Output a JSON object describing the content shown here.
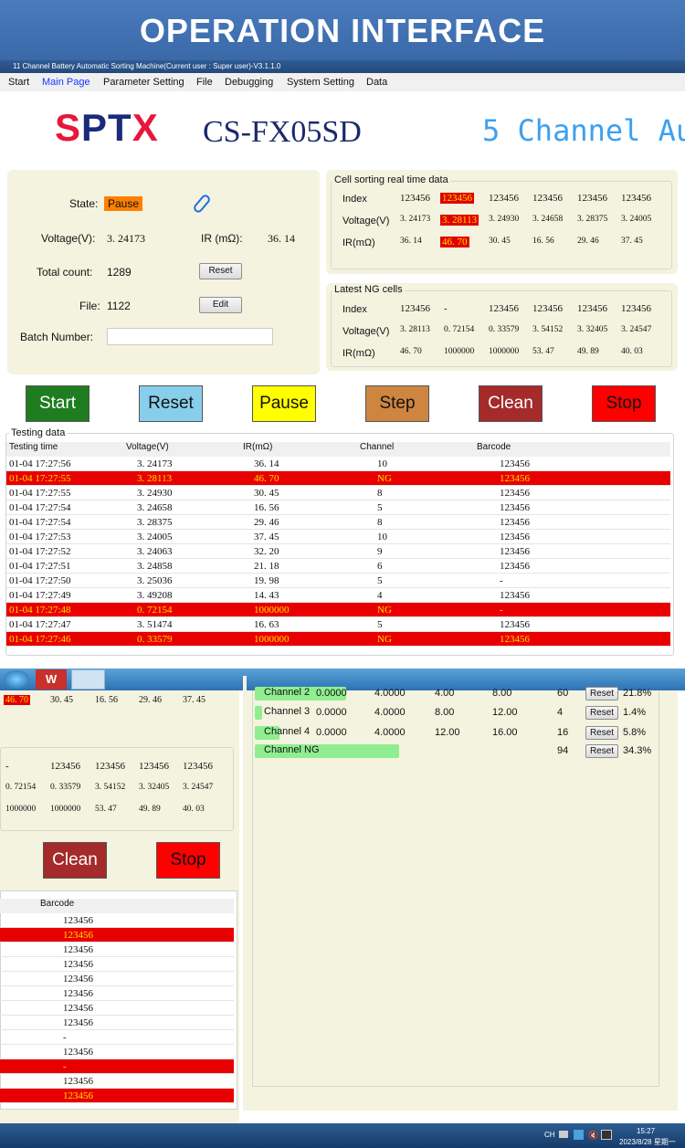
{
  "banner": {
    "title": "OPERATION INTERFACE"
  },
  "window": {
    "title": "11 Channel Battery Automatic Sorting Machine(Current user : Super user)-V3.1.1.0"
  },
  "menu": [
    "Start",
    "Main Page",
    "Parameter Setting",
    "File",
    "Debugging",
    "System Setting",
    "Data"
  ],
  "logo": {
    "brand": "SPTX",
    "model": "CS-FX05SD",
    "subtitle": "5 Channel Aut"
  },
  "status": {
    "state_label": "State:",
    "state_value": "Pause",
    "voltage_label": "Voltage(V):",
    "voltage_value": "3. 24173",
    "ir_label": "IR (mΩ):",
    "ir_value": "36. 14",
    "total_label": "Total count:",
    "total_value": "1289",
    "reset_label": "Reset",
    "file_label": "File:",
    "file_value": "1122",
    "edit_label": "Edit",
    "batch_label": "Batch Number:",
    "batch_value": ""
  },
  "realtime": {
    "title": "Cell sorting real time data",
    "row_labels": [
      "Index",
      "Voltage(V)",
      "IR(mΩ)"
    ],
    "index": [
      "123456",
      "123456",
      "123456",
      "123456",
      "123456",
      "123456"
    ],
    "voltage": [
      "3. 24173",
      "3. 28113",
      "3. 24930",
      "3. 24658",
      "3. 28375",
      "3. 24005"
    ],
    "ir": [
      "36. 14",
      "46. 70",
      "30. 45",
      "16. 56",
      "29. 46",
      "37. 45"
    ],
    "highlight_col": 1
  },
  "latest_ng": {
    "title": "Latest NG cells",
    "row_labels": [
      "Index",
      "Voltage(V)",
      "IR(mΩ)"
    ],
    "index": [
      "123456",
      "-",
      "123456",
      "123456",
      "123456",
      "123456"
    ],
    "voltage": [
      "3. 28113",
      "0. 72154",
      "0. 33579",
      "3. 54152",
      "3. 32405",
      "3. 24547"
    ],
    "ir": [
      "46. 70",
      "1000000",
      "1000000",
      "53. 47",
      "49. 89",
      "40. 03"
    ]
  },
  "buttons": [
    {
      "label": "Start",
      "color": "#1e7d1e",
      "text": "#ffffff"
    },
    {
      "label": "Reset",
      "color": "#87ceeb",
      "text": "#111111"
    },
    {
      "label": "Pause",
      "color": "#ffff00",
      "text": "#111111"
    },
    {
      "label": "Step",
      "color": "#cd853f",
      "text": "#111111"
    },
    {
      "label": "Clean",
      "color": "#a52a2a",
      "text": "#ffffff"
    },
    {
      "label": "Stop",
      "color": "#ff0000",
      "text": "#111111"
    }
  ],
  "testing": {
    "title": "Testing data",
    "columns": [
      "Testing time",
      "Voltage(V)",
      "IR(mΩ)",
      "Channel",
      "Barcode"
    ],
    "rows": [
      {
        "time": "01-04 17:27:56",
        "v": "3. 24173",
        "ir": "36. 14",
        "ch": "10",
        "bc": "123456",
        "ng": false
      },
      {
        "time": "01-04 17:27:55",
        "v": "3. 28113",
        "ir": "46. 70",
        "ch": "NG",
        "bc": "123456",
        "ng": true
      },
      {
        "time": "01-04 17:27:55",
        "v": "3. 24930",
        "ir": "30. 45",
        "ch": "8",
        "bc": "123456",
        "ng": false
      },
      {
        "time": "01-04 17:27:54",
        "v": "3. 24658",
        "ir": "16. 56",
        "ch": "5",
        "bc": "123456",
        "ng": false
      },
      {
        "time": "01-04 17:27:54",
        "v": "3. 28375",
        "ir": "29. 46",
        "ch": "8",
        "bc": "123456",
        "ng": false
      },
      {
        "time": "01-04 17:27:53",
        "v": "3. 24005",
        "ir": "37. 45",
        "ch": "10",
        "bc": "123456",
        "ng": false
      },
      {
        "time": "01-04 17:27:52",
        "v": "3. 24063",
        "ir": "32. 20",
        "ch": "9",
        "bc": "123456",
        "ng": false
      },
      {
        "time": "01-04 17:27:51",
        "v": "3. 24858",
        "ir": "21. 18",
        "ch": "6",
        "bc": "123456",
        "ng": false
      },
      {
        "time": "01-04 17:27:50",
        "v": "3. 25036",
        "ir": "19. 98",
        "ch": "5",
        "bc": "-",
        "ng": false
      },
      {
        "time": "01-04 17:27:49",
        "v": "3. 49208",
        "ir": "14. 43",
        "ch": "4",
        "bc": "123456",
        "ng": false
      },
      {
        "time": "01-04 17:27:48",
        "v": "0. 72154",
        "ir": "1000000",
        "ch": "NG",
        "bc": "-",
        "ng": true
      },
      {
        "time": "01-04 17:27:47",
        "v": "3. 51474",
        "ir": "16. 63",
        "ch": "5",
        "bc": "123456",
        "ng": false
      },
      {
        "time": "01-04 17:27:46",
        "v": "0. 33579",
        "ir": "1000000",
        "ch": "NG",
        "bc": "123456",
        "ng": true
      }
    ]
  },
  "channels": [
    {
      "name": "Channel 2",
      "a": "0.0000",
      "b": "4.0000",
      "min": "4.00",
      "max": "8.00",
      "count": "60",
      "reset": "Reset",
      "pct": "21.8%",
      "fill": 21.8
    },
    {
      "name": "Channel 3",
      "a": "0.0000",
      "b": "4.0000",
      "min": "8.00",
      "max": "12.00",
      "count": "4",
      "reset": "Reset",
      "pct": "1.4%",
      "fill": 1.4
    },
    {
      "name": "Channel 4",
      "a": "0.0000",
      "b": "4.0000",
      "min": "12.00",
      "max": "16.00",
      "count": "16",
      "reset": "Reset",
      "pct": "5.8%",
      "fill": 5.8
    },
    {
      "name": "Channel NG",
      "a": "",
      "b": "",
      "min": "",
      "max": "",
      "count": "94",
      "reset": "Reset",
      "pct": "34.3%",
      "fill": 34.3
    }
  ],
  "tray": {
    "lang": "CH",
    "time": "15:27",
    "date": "2023/8/28 星期一"
  }
}
